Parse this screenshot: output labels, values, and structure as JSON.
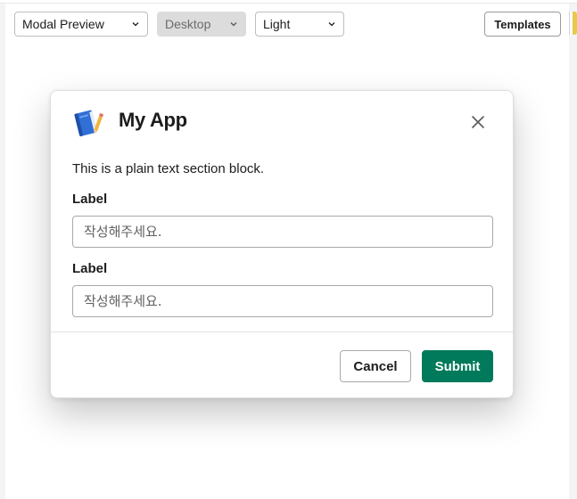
{
  "toolbar": {
    "preview_mode": {
      "value": "Modal Preview",
      "icon": "chevron-down-icon"
    },
    "device": {
      "value": "Desktop",
      "icon": "chevron-down-icon",
      "disabled": true
    },
    "theme": {
      "value": "Light",
      "icon": "chevron-down-icon"
    },
    "templates_label": "Templates"
  },
  "modal": {
    "app_icon": "blue-book-pencil-icon",
    "title": "My App",
    "close_icon": "close-icon",
    "section_text": "This is a plain text section block.",
    "fields": [
      {
        "label": "Label",
        "placeholder": "작성해주세요."
      },
      {
        "label": "Label",
        "placeholder": "작성해주세요."
      }
    ],
    "cancel_label": "Cancel",
    "submit_label": "Submit"
  },
  "colors": {
    "submit": "#007a5a",
    "text": "#1d1c1d",
    "background": "#ffffff",
    "disabled_select": "#dcdcdc"
  }
}
